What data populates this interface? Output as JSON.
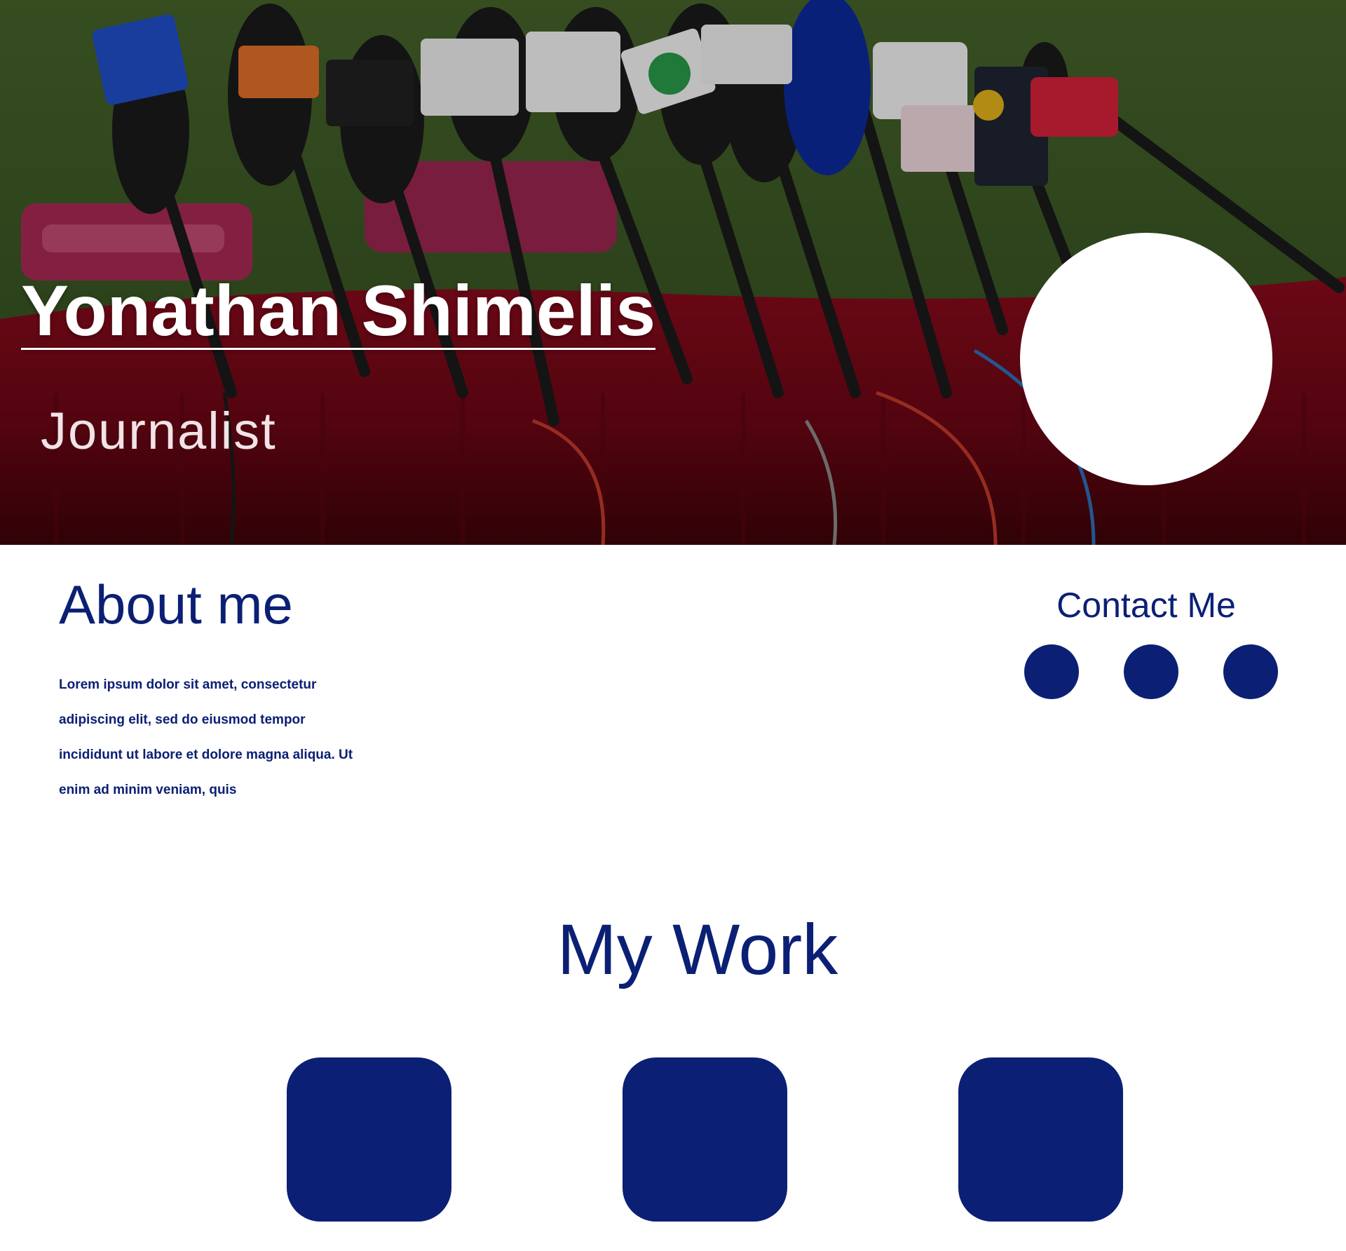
{
  "hero": {
    "name": "Yonathan Shimelis",
    "role": "Journalist",
    "background_image": "microphones-on-red-table",
    "overlay_color": "#000000"
  },
  "about": {
    "title": "About me",
    "text": "Lorem ipsum dolor sit amet, consectetur adipiscing elit, sed do eiusmod tempor incididunt ut labore et dolore magna aliqua. Ut enim ad minim veniam, quis"
  },
  "contact": {
    "title": "Contact Me",
    "links": [
      {
        "icon": "social-link-icon"
      },
      {
        "icon": "social-link-icon"
      },
      {
        "icon": "social-link-icon"
      }
    ]
  },
  "work": {
    "title": "My Work",
    "cards": [
      {
        "icon": "work-item"
      },
      {
        "icon": "work-item"
      },
      {
        "icon": "work-item"
      }
    ]
  },
  "colors": {
    "accent": "#0b2074",
    "background": "#ffffff",
    "hero_text": "#ffffff"
  }
}
